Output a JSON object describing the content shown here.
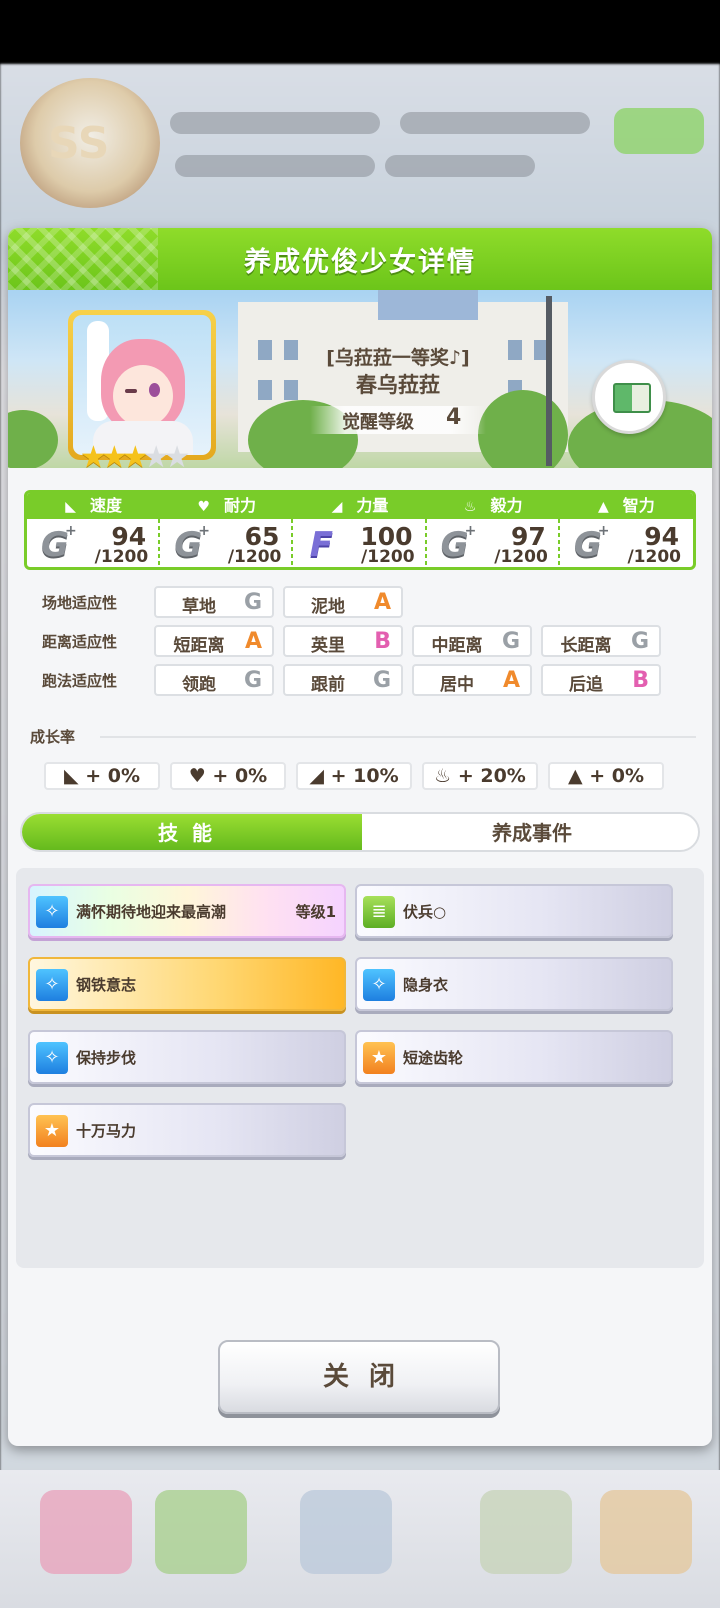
{
  "dialog": {
    "title": "养成优俊少女详情"
  },
  "character": {
    "subtitle": "[乌菈菈一等奖♪]",
    "name": "春乌菈菈",
    "awakening_label": "觉醒等级",
    "awakening_level": "4",
    "star_rating": 3,
    "star_max": 5
  },
  "stats": [
    {
      "label": "速度",
      "icon": "shoe-icon",
      "grade": "G",
      "plus": "+",
      "value": "94",
      "max": "/1200"
    },
    {
      "label": "耐力",
      "icon": "heart-icon",
      "grade": "G",
      "plus": "+",
      "value": "65",
      "max": "/1200"
    },
    {
      "label": "力量",
      "icon": "muscle-icon",
      "grade": "F",
      "plus": "",
      "value": "100",
      "max": "/1200"
    },
    {
      "label": "毅力",
      "icon": "flame-icon",
      "grade": "G",
      "plus": "+",
      "value": "97",
      "max": "/1200"
    },
    {
      "label": "智力",
      "icon": "graduation-cap-icon",
      "grade": "G",
      "plus": "+",
      "value": "94",
      "max": "/1200"
    }
  ],
  "aptitudes": {
    "track": {
      "label": "场地适应性",
      "items": [
        {
          "name": "草地",
          "grade": "G"
        },
        {
          "name": "泥地",
          "grade": "A"
        }
      ]
    },
    "distance": {
      "label": "距离适应性",
      "items": [
        {
          "name": "短距离",
          "grade": "A"
        },
        {
          "name": "英里",
          "grade": "B"
        },
        {
          "name": "中距离",
          "grade": "G"
        },
        {
          "name": "长距离",
          "grade": "G"
        }
      ]
    },
    "style": {
      "label": "跑法适应性",
      "items": [
        {
          "name": "领跑",
          "grade": "G"
        },
        {
          "name": "跟前",
          "grade": "G"
        },
        {
          "name": "居中",
          "grade": "A"
        },
        {
          "name": "后追",
          "grade": "B"
        }
      ]
    }
  },
  "growth": {
    "label": "成长率",
    "items": [
      {
        "icon": "shoe-icon",
        "value": "+ 0%"
      },
      {
        "icon": "heart-icon",
        "value": "+ 0%"
      },
      {
        "icon": "muscle-icon",
        "value": "+ 10%"
      },
      {
        "icon": "flame-icon",
        "value": "+ 20%"
      },
      {
        "icon": "graduation-cap-icon",
        "value": "+ 0%"
      }
    ]
  },
  "tabs": {
    "skills": "技能",
    "events": "养成事件"
  },
  "skills": [
    {
      "name": "满怀期待地迎来最高潮",
      "level": "等级1",
      "style": "rainbow",
      "icon": "sparkle-icon"
    },
    {
      "name": "伏兵○",
      "level": "",
      "style": "plain",
      "icon": "card-icon"
    },
    {
      "name": "钢铁意志",
      "level": "",
      "style": "gold",
      "icon": "sparkle-icon"
    },
    {
      "name": "隐身衣",
      "level": "",
      "style": "plain",
      "icon": "sparkle-icon"
    },
    {
      "name": "保持步伐",
      "level": "",
      "style": "plain",
      "icon": "sparkle-icon"
    },
    {
      "name": "短途齿轮",
      "level": "",
      "style": "plain",
      "icon": "runner-icon"
    },
    {
      "name": "十万马力",
      "level": "",
      "style": "plain",
      "icon": "runner-icon"
    }
  ],
  "close_button": "关闭",
  "colors": {
    "header_green": "#79cc29",
    "gold_star": "#f5c21b",
    "grade_A": "#f08a2c",
    "grade_B": "#e35fb0",
    "grade_G": "#9aa0a6"
  }
}
